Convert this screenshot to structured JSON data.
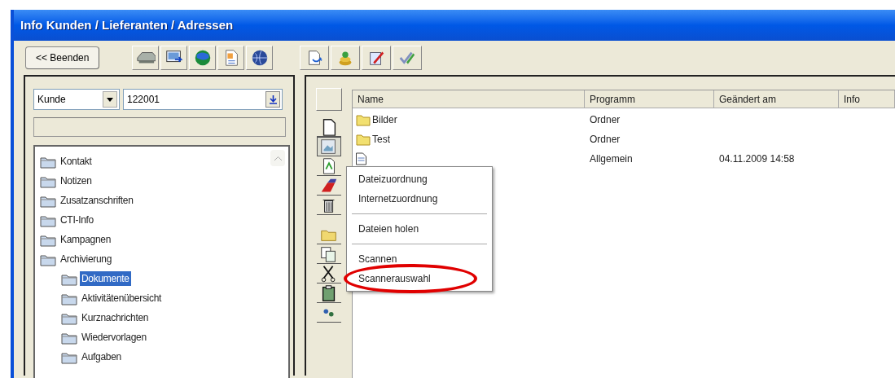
{
  "window": {
    "title": "Info Kunden / Lieferanten / Adressen"
  },
  "toolbar": {
    "exit_button": "<< Beenden"
  },
  "search": {
    "type_select": "Kunde",
    "number_field": "122001"
  },
  "tree": [
    {
      "label": "Kontakt",
      "selected": false
    },
    {
      "label": "Notizen",
      "selected": false
    },
    {
      "label": "Zusatzanschriften",
      "selected": false
    },
    {
      "label": "CTI-Info",
      "selected": false
    },
    {
      "label": "Kampagnen",
      "selected": false
    },
    {
      "label": "Archivierung",
      "selected": false,
      "children": [
        {
          "label": "Dokumente",
          "selected": true
        },
        {
          "label": "Aktivitätenübersicht",
          "selected": false
        },
        {
          "label": "Kurznachrichten",
          "selected": false
        },
        {
          "label": "Wiedervorlagen",
          "selected": false
        },
        {
          "label": "Aufgaben",
          "selected": false
        }
      ]
    }
  ],
  "file_list": {
    "columns": [
      "Name",
      "Programm",
      "Geändert am",
      "Info"
    ],
    "rows": [
      {
        "kind": "folder",
        "name": "Bilder",
        "program": "Ordner"
      },
      {
        "kind": "folder",
        "name": "Test",
        "program": "Ordner"
      },
      {
        "kind": "document",
        "program": "Allgemein",
        "changed": "04.11.2009 14:58"
      }
    ]
  },
  "context_menu": {
    "items": [
      {
        "kind": "item",
        "label": "Dateizuordnung",
        "highlighted": false
      },
      {
        "kind": "item",
        "label": "Internetzuordnung",
        "highlighted": false
      },
      {
        "kind": "separator"
      },
      {
        "kind": "item",
        "label": "Dateien holen",
        "highlighted": false
      },
      {
        "kind": "separator"
      },
      {
        "kind": "item",
        "label": "Scannen",
        "highlighted": false
      },
      {
        "kind": "item",
        "label": "Scannerauswahl",
        "highlighted": true
      }
    ]
  }
}
